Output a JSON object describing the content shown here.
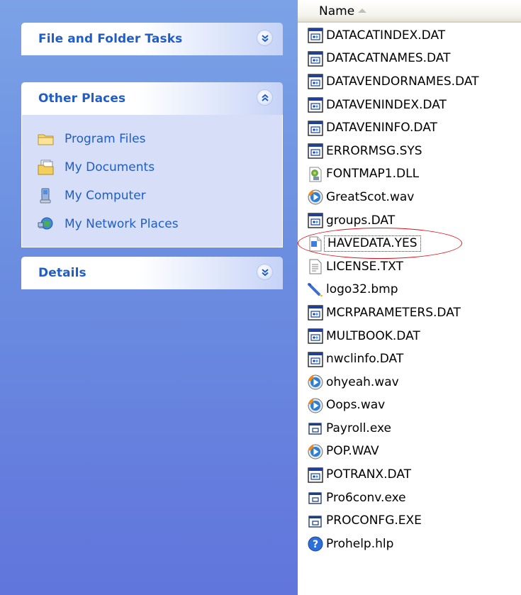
{
  "task_pane": {
    "panels": [
      {
        "title": "File and Folder Tasks",
        "state": "collapsed"
      },
      {
        "title": "Other Places",
        "state": "expanded",
        "items": [
          {
            "label": "Program Files",
            "icon": "folder-icon"
          },
          {
            "label": "My Documents",
            "icon": "my-documents-icon"
          },
          {
            "label": "My Computer",
            "icon": "my-computer-icon"
          },
          {
            "label": "My Network Places",
            "icon": "network-places-icon"
          }
        ]
      },
      {
        "title": "Details",
        "state": "collapsed"
      }
    ]
  },
  "file_list": {
    "column_header": "Name",
    "sort": "ascending",
    "files": [
      {
        "name": "DATACATINDEX.DAT",
        "icon": "dat-file-icon"
      },
      {
        "name": "DATACATNAMES.DAT",
        "icon": "dat-file-icon"
      },
      {
        "name": "DATAVENDORNAMES.DAT",
        "icon": "dat-file-icon"
      },
      {
        "name": "DATAVENINDEX.DAT",
        "icon": "dat-file-icon"
      },
      {
        "name": "DATAVENINFO.DAT",
        "icon": "dat-file-icon"
      },
      {
        "name": "ERRORMSG.SYS",
        "icon": "sys-file-icon"
      },
      {
        "name": "FONTMAP1.DLL",
        "icon": "dll-file-icon"
      },
      {
        "name": "GreatScot.wav",
        "icon": "wav-file-icon"
      },
      {
        "name": "groups.DAT",
        "icon": "dat-file-icon"
      },
      {
        "name": "HAVEDATA.YES",
        "icon": "generic-file-icon",
        "highlighted": true
      },
      {
        "name": "LICENSE.TXT",
        "icon": "text-file-icon"
      },
      {
        "name": "logo32.bmp",
        "icon": "bmp-file-icon"
      },
      {
        "name": "MCRPARAMETERS.DAT",
        "icon": "dat-file-icon"
      },
      {
        "name": "MULTBOOK.DAT",
        "icon": "dat-file-icon"
      },
      {
        "name": "nwclinfo.DAT",
        "icon": "dat-file-icon"
      },
      {
        "name": "ohyeah.wav",
        "icon": "wav-file-icon"
      },
      {
        "name": "Oops.wav",
        "icon": "wav-file-icon"
      },
      {
        "name": "Payroll.exe",
        "icon": "exe-file-icon"
      },
      {
        "name": "POP.WAV",
        "icon": "wav-file-icon"
      },
      {
        "name": "POTRANX.DAT",
        "icon": "dat-file-icon"
      },
      {
        "name": "Pro6conv.exe",
        "icon": "exe-file-icon"
      },
      {
        "name": "PROCONFG.EXE",
        "icon": "exe-file-icon"
      },
      {
        "name": "Prohelp.hlp",
        "icon": "help-file-icon"
      }
    ]
  },
  "colors": {
    "pane_gradient_top": "#7ba2e7",
    "pane_gradient_bottom": "#6175dc",
    "panel_title": "#215dc6",
    "panel_body": "#d6dff7",
    "highlight_ellipse": "#e0121b"
  }
}
